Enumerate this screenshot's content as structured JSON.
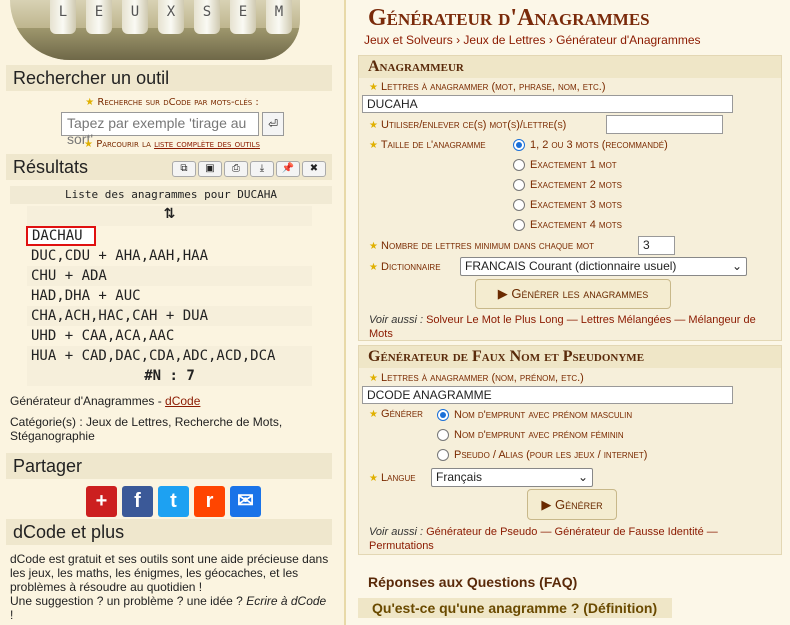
{
  "left": {
    "lock_letters": [
      "L",
      "E",
      "U",
      "X",
      "S",
      "E",
      "M"
    ],
    "search_tool": {
      "heading": "Rechercher un outil",
      "keyword_label": "Recherche sur dCode par mots-clés :",
      "input_placeholder": "Tapez par exemple 'tirage au sort'",
      "browse_prefix": "Parcourir la",
      "browse_link": "liste complète des outils"
    },
    "results": {
      "heading": "Résultats",
      "toolbar_icons": [
        "copy-icon",
        "save-icon",
        "print-icon",
        "download-icon",
        "pin-icon",
        "close-icon"
      ],
      "list_title": "Liste des anagrammes pour DUCAHA",
      "sort_arrows": "⇅",
      "rows": [
        "DACHAU",
        "DUC,CDU + AHA,AAH,HAA",
        "CHU + ADA",
        "HAD,DHA + AUC",
        "CHA,ACH,HAC,CAH + DUA",
        "UHD + CAA,ACA,AAC",
        "HUA + CAD,DAC,CDA,ADC,ACD,DCA"
      ],
      "count_label": "#N : 7",
      "tool_prefix": "Générateur d'Anagrammes -",
      "tool_link": "dCode",
      "category_label": "Catégorie(s) :",
      "category_value": "Jeux de Lettres, Recherche de Mots, Stéganographie"
    },
    "share": {
      "heading": "Partager",
      "buttons": [
        "+",
        "f",
        "t",
        "r",
        "✉"
      ]
    },
    "about": {
      "heading": "dCode et plus",
      "text1": "dCode est gratuit et ses outils sont une aide précieuse dans les jeux, les maths, les énigmes, les géocaches, et les problèmes à résoudre au quotidien !",
      "text2": "Une suggestion ? un problème ? une idée ?",
      "text3": "Ecrire à dCode",
      "text4": "!"
    }
  },
  "right": {
    "title": "Générateur d'Anagrammes",
    "breadcrumb": [
      "Jeux et Solveurs",
      "Jeux de Lettres",
      "Générateur d'Anagrammes"
    ],
    "breadcrumb_sep": "›",
    "anagrammer": {
      "heading": "Anagrammeur",
      "letters_label": "Lettres à anagrammer (mot, phrase, nom, etc.)",
      "letters_value": "DUCAHA",
      "use_label": "Utiliser/enlever ce(s) mot(s)/lettre(s)",
      "use_value": "",
      "size_label": "Taille de l'anagramme",
      "size_options": [
        "1, 2 ou 3 mots (recommandé)",
        "Exactement 1 mot",
        "Exactement 2 mots",
        "Exactement 3 mots",
        "Exactement 4 mots"
      ],
      "size_selected": 0,
      "min_letters_label": "Nombre de lettres minimum dans chaque mot",
      "min_letters_value": "3",
      "dict_label": "Dictionnaire",
      "dict_value": "FRANCAIS Courant (dictionnaire usuel)",
      "button": "▶ Générer les anagrammes",
      "see_also_prefix": "Voir aussi :",
      "see_also": [
        "Solveur Le Mot le Plus Long",
        "Lettres Mélangées",
        "Mélangeur de Mots"
      ],
      "see_also_sep": "—"
    },
    "pseudo": {
      "heading": "Générateur de Faux Nom et Pseudonyme",
      "letters_label": "Lettres à anagrammer (nom, prénom, etc.)",
      "letters_value": "DCODE ANAGRAMME",
      "generate_label": "Générer",
      "options": [
        "Nom d'emprunt avec prénom masculin",
        "Nom d'emprunt avec prénom féminin",
        "Pseudo / Alias (pour les jeux / internet)"
      ],
      "selected": 0,
      "lang_label": "Langue",
      "lang_value": "Français",
      "button": "▶ Générer",
      "see_also_prefix": "Voir aussi :",
      "see_also": [
        "Générateur de Pseudo",
        "Générateur de Fausse Identité",
        "Permutations"
      ],
      "see_also_sep": "—"
    },
    "faq": {
      "heading": "Réponses aux Questions (FAQ)",
      "q1": "Qu'est-ce qu'une anagramme ? (Définition)"
    }
  },
  "colors": {
    "accent": "#8b1a00",
    "highlight_border": "#e01010",
    "share": [
      "#cc1f1f",
      "#3b5998",
      "#1da1f2",
      "#ff4500",
      "#1a73e8"
    ]
  }
}
